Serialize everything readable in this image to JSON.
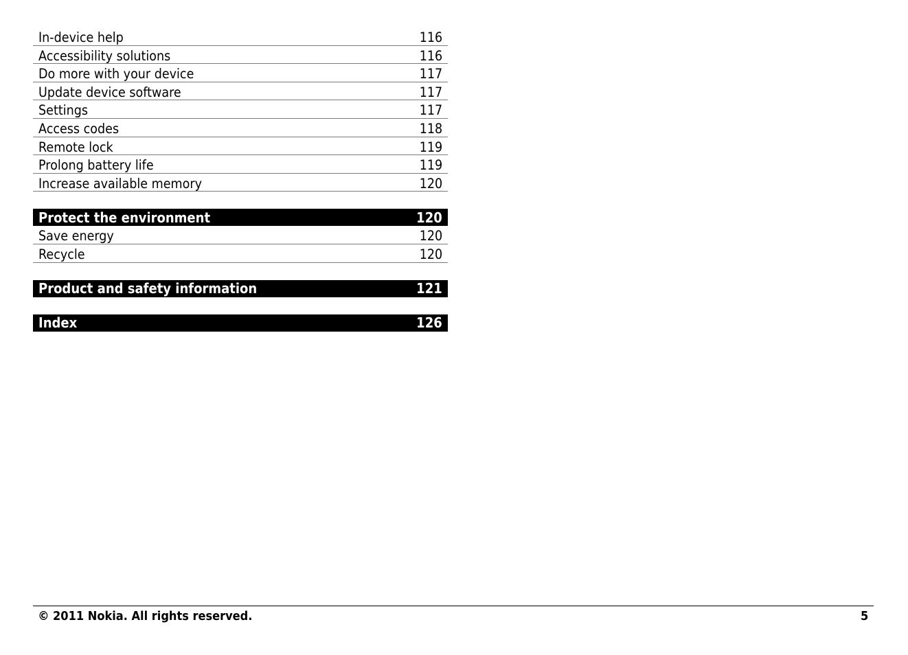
{
  "toc": {
    "group1": [
      {
        "title": "In-device help",
        "page": "116"
      },
      {
        "title": "Accessibility solutions",
        "page": "116"
      },
      {
        "title": "Do more with your device",
        "page": "117"
      },
      {
        "title": "Update device software",
        "page": "117"
      },
      {
        "title": "Settings",
        "page": "117"
      },
      {
        "title": "Access codes",
        "page": "118"
      },
      {
        "title": "Remote lock",
        "page": "119"
      },
      {
        "title": "Prolong battery life",
        "page": "119"
      },
      {
        "title": "Increase available memory",
        "page": "120"
      }
    ],
    "sections": [
      {
        "title": "Protect the environment",
        "page": "120",
        "items": [
          {
            "title": "Save energy",
            "page": "120"
          },
          {
            "title": "Recycle",
            "page": "120"
          }
        ]
      },
      {
        "title": "Product and safety information",
        "page": "121",
        "items": []
      },
      {
        "title": "Index",
        "page": "126",
        "items": []
      }
    ]
  },
  "footer": {
    "copyright": "© 2011 Nokia. All rights reserved.",
    "page_number": "5"
  }
}
